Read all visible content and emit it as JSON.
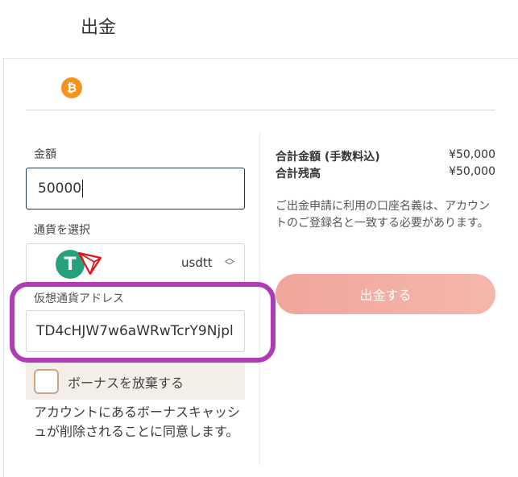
{
  "header": {
    "title": "出金"
  },
  "tabs": {
    "crypto_icon": "bitcoin-icon",
    "crypto_glyph": "₿"
  },
  "form": {
    "amount_label": "金額",
    "amount_value": "50000",
    "currency_label": "通貨を選択",
    "currency_value": "usdtt",
    "currency_icons": [
      "tether-icon",
      "tron-icon"
    ],
    "usdt_glyph": "T",
    "address_label": "仮想通貨アドレス",
    "address_value": "TD4cHJW7w6aWRwTcrY9Njpl",
    "bonus_label": "ボーナスを放棄する",
    "bonus_note": "アカウントにあるボーナスキャッシュが削除されることに同意します。"
  },
  "summary": {
    "total_amount_label": "合計金額 (手数料込)",
    "total_amount_value": "¥50,000",
    "total_balance_label": "合計残高",
    "total_balance_value": "¥50,000",
    "notice": "ご出金申請に利用の口座名義は、アカウントのご登録名と一致する必要があります。",
    "withdraw_button": "出金する"
  },
  "colors": {
    "bitcoin": "#f7931a",
    "tether": "#26a17b",
    "tron": "#e5121b",
    "highlight": "#b03cb5",
    "button": "#f2a59a"
  }
}
